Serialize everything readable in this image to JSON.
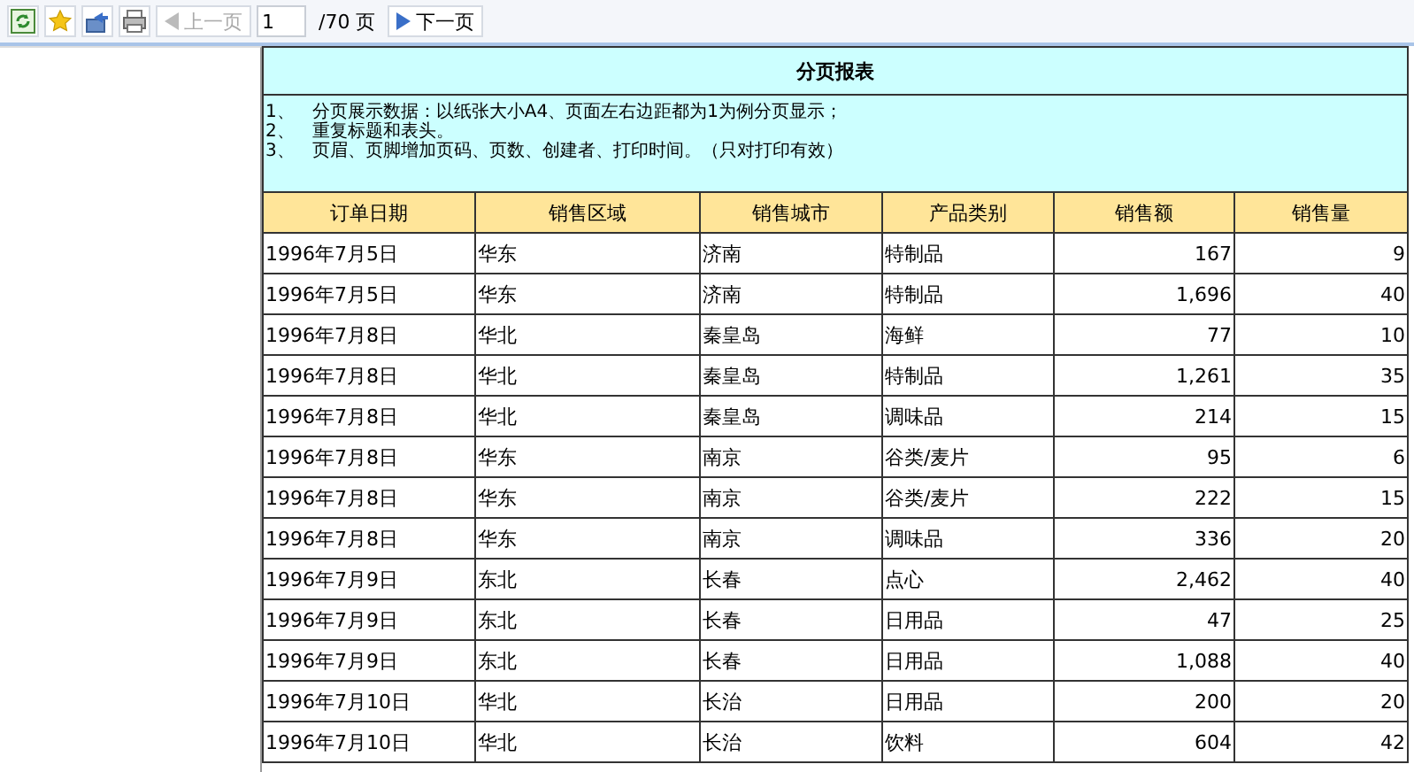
{
  "toolbar": {
    "prev_button": {
      "label": "上一页",
      "disabled": true
    },
    "page_input": {
      "value": "1"
    },
    "page_total": "/70 页",
    "next_button": {
      "label": "下一页",
      "disabled": false
    }
  },
  "report": {
    "title": "分页报表",
    "notes": [
      "1、　分页展示数据：以纸张大小A4、页面左右边距都为1为例分页显示；",
      "2、　重复标题和表头。",
      "3、　页眉、页脚增加页码、页数、创建者、打印时间。（只对打印有效）"
    ],
    "columns": [
      "订单日期",
      "销售区域",
      "销售城市",
      "产品类别",
      "销售额",
      "销售量"
    ],
    "rows": [
      [
        "1996年7月5日",
        "华东",
        "济南",
        "特制品",
        "167",
        "9"
      ],
      [
        "1996年7月5日",
        "华东",
        "济南",
        "特制品",
        "1,696",
        "40"
      ],
      [
        "1996年7月8日",
        "华北",
        "秦皇岛",
        "海鲜",
        "77",
        "10"
      ],
      [
        "1996年7月8日",
        "华北",
        "秦皇岛",
        "特制品",
        "1,261",
        "35"
      ],
      [
        "1996年7月8日",
        "华北",
        "秦皇岛",
        "调味品",
        "214",
        "15"
      ],
      [
        "1996年7月8日",
        "华东",
        "南京",
        "谷类/麦片",
        "95",
        "6"
      ],
      [
        "1996年7月8日",
        "华东",
        "南京",
        "谷类/麦片",
        "222",
        "15"
      ],
      [
        "1996年7月8日",
        "华东",
        "南京",
        "调味品",
        "336",
        "20"
      ],
      [
        "1996年7月9日",
        "东北",
        "长春",
        "点心",
        "2,462",
        "40"
      ],
      [
        "1996年7月9日",
        "东北",
        "长春",
        "日用品",
        "47",
        "25"
      ],
      [
        "1996年7月9日",
        "东北",
        "长春",
        "日用品",
        "1,088",
        "40"
      ],
      [
        "1996年7月10日",
        "华北",
        "长治",
        "日用品",
        "200",
        "20"
      ],
      [
        "1996年7月10日",
        "华北",
        "长治",
        "饮料",
        "604",
        "42"
      ]
    ]
  }
}
